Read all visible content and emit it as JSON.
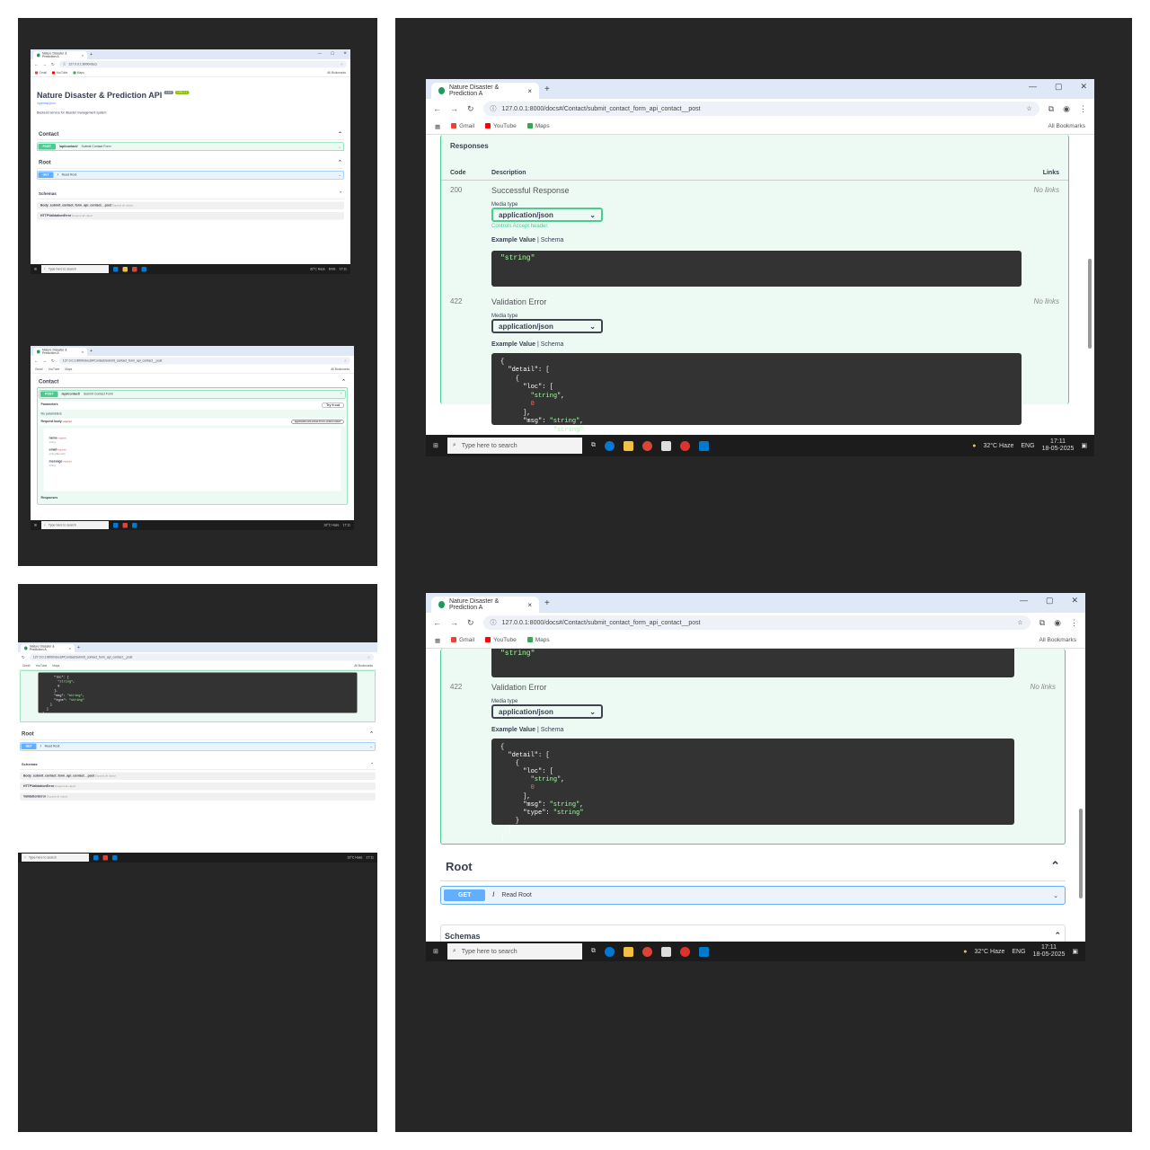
{
  "browser": {
    "tab_title": "Nature Disaster & Prediction A",
    "url_home": "127.0.0.1:8000/docs",
    "url_contact": "127.0.0.1:8000/docs#/Contact/submit_contact_form_api_contact__post",
    "bookmarks": [
      "Gmail",
      "YouTube",
      "Maps"
    ],
    "all_bookmarks": "All Bookmarks"
  },
  "taskbar": {
    "search_placeholder": "Type here to search",
    "weather": "32°C Haze",
    "lang": "ENG",
    "time": "17:11",
    "date": "18-05-2025"
  },
  "api": {
    "title": "Nature Disaster & Prediction API",
    "version": "1.0.0",
    "oas": "OAS 3.1",
    "link": "/openapi.json",
    "description": "Backend service for disaster management system"
  },
  "sections": {
    "contact": "Contact",
    "root": "Root",
    "schemas": "Schemas"
  },
  "operations": {
    "post_method": "POST",
    "post_path": "/api/contact/",
    "post_summary": "Submit Contact Form",
    "get_method": "GET",
    "get_path": "/",
    "get_summary": "Read Root"
  },
  "schemas": [
    {
      "name": "Body_submit_contact_form_api_contact__post",
      "expand": "Expand all",
      "type": "object"
    },
    {
      "name": "HTTPValidationError",
      "expand": "Expand all",
      "type": "object"
    },
    {
      "name": "ValidationError",
      "expand": "Expand all",
      "type": "object"
    }
  ],
  "request": {
    "parameters": "Parameters",
    "try_it_out": "Try it out",
    "no_parameters": "No parameters",
    "request_body": "Request body",
    "required": "required",
    "content_type": "application/x-www-form-urlencoded",
    "fields": [
      {
        "name": "name",
        "type": "string"
      },
      {
        "name": "email",
        "type": "string($email)"
      },
      {
        "name": "message",
        "type": "string"
      }
    ]
  },
  "responses": {
    "title": "Responses",
    "col_code": "Code",
    "col_description": "Description",
    "col_links": "Links",
    "media_type_label": "Media type",
    "media_type": "application/json",
    "controls_accept": "Controls Accept header.",
    "example_value": "Example Value",
    "schema": "Schema",
    "no_links": "No links",
    "items": [
      {
        "code": "200",
        "description": "Successful Response",
        "example": "\"string\""
      },
      {
        "code": "422",
        "description": "Validation Error",
        "example": "{\n  \"detail\": [\n    {\n      \"loc\": [\n        \"string\",\n        0\n      ],\n      \"msg\": \"string\",\n      \"type\": \"string\"\n    }\n  ]\n}"
      }
    ]
  },
  "colors": {
    "post": "#49cc90",
    "get": "#61affe",
    "panel": "#262626"
  }
}
